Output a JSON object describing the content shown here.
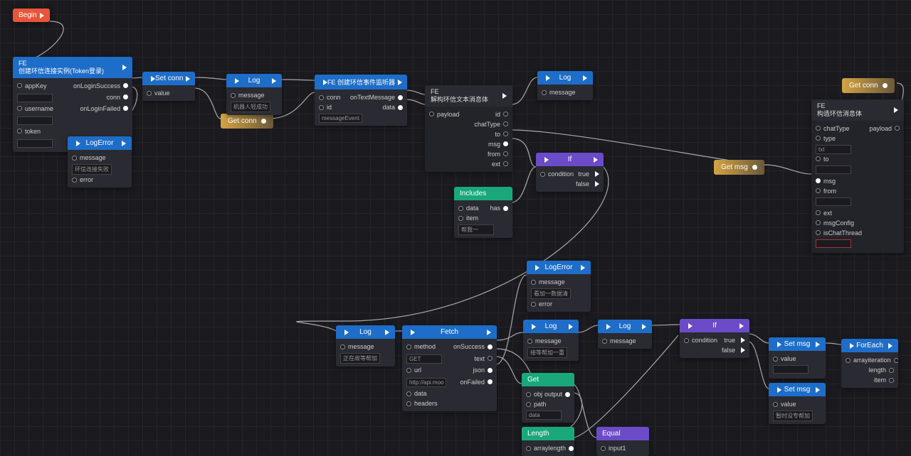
{
  "nodes": {
    "begin": {
      "title": "Begin"
    },
    "fe_login": {
      "title": "FE\n创建环信连接实例(Token登录)",
      "inputs": [
        "appKey",
        "username",
        "token"
      ],
      "outputs": [
        "onLoginSuccess",
        "conn",
        "onLoginFailed"
      ]
    },
    "set_conn": {
      "title": "Set conn",
      "inputs": [
        "value"
      ]
    },
    "get_conn": {
      "title": "Get conn"
    },
    "log1": {
      "title": "Log",
      "inputs": [
        "message"
      ],
      "value": "机器人轻成功"
    },
    "fe_event": {
      "title": "FE 创建环信事件监听器",
      "inputs": [
        "conn",
        "id"
      ],
      "outputs": [
        "onTextMessage",
        "data"
      ],
      "id_value": "messageEvent"
    },
    "fe_parse": {
      "title": "FE\n解构环信文本消息体",
      "inputs": [
        "payload"
      ],
      "outputs": [
        "id",
        "chatType",
        "to",
        "msg",
        "from",
        "ext"
      ]
    },
    "log2": {
      "title": "Log",
      "inputs": [
        "message"
      ]
    },
    "log_error1": {
      "title": "LogError",
      "inputs": [
        "message",
        "error"
      ],
      "value": "环信连接失败"
    },
    "if1": {
      "title": "If",
      "inputs": [
        "condition"
      ],
      "outputs": [
        "true",
        "false"
      ]
    },
    "includes": {
      "title": "Includes",
      "inputs": [
        "data",
        "item"
      ],
      "outputs": [
        "has"
      ],
      "value": "帮我一"
    },
    "get_msg": {
      "title": "Get msg"
    },
    "fe_build": {
      "title": "FE\n构造环信消息体",
      "inputs": [
        "chatType",
        "type",
        "to",
        "msg",
        "from",
        "ext",
        "msgConfig",
        "isChatThread"
      ],
      "outputs": [
        "payload"
      ],
      "type_value": "txt"
    },
    "get_conn2": {
      "title": "Get conn"
    },
    "log_error2": {
      "title": "LogError",
      "inputs": [
        "message",
        "error"
      ],
      "value": "看加一数据清"
    },
    "log3": {
      "title": "Log",
      "inputs": [
        "message"
      ],
      "value": "正在故等帮加"
    },
    "fetch": {
      "title": "Fetch",
      "inputs": [
        "method",
        "url",
        "data",
        "headers"
      ],
      "outputs": [
        "onSuccess",
        "text",
        "json",
        "onFailed"
      ],
      "method_value": "GET",
      "url_value": "http://api.moo"
    },
    "log4": {
      "title": "Log",
      "inputs": [
        "message"
      ],
      "value": "接等帮加一重"
    },
    "log5": {
      "title": "Log",
      "inputs": [
        "message"
      ]
    },
    "if2": {
      "title": "If",
      "inputs": [
        "condition"
      ],
      "outputs": [
        "true",
        "false"
      ]
    },
    "set_msg1": {
      "title": "Set msg",
      "inputs": [
        "value"
      ]
    },
    "set_msg2": {
      "title": "Set msg",
      "inputs": [
        "value"
      ],
      "value": "暂时没专帮加"
    },
    "foreach": {
      "title": "ForEach",
      "inputs": [
        "array"
      ],
      "outputs": [
        "iteration",
        "length",
        "item"
      ]
    },
    "get": {
      "title": "Get",
      "inputs": [
        "obj",
        "path"
      ],
      "outputs": [
        "output"
      ],
      "path_value": "data"
    },
    "length": {
      "title": "Length",
      "inputs": [
        "array"
      ],
      "outputs": [
        "length"
      ]
    },
    "equal": {
      "title": "Equal",
      "inputs": [
        "input1"
      ]
    }
  }
}
